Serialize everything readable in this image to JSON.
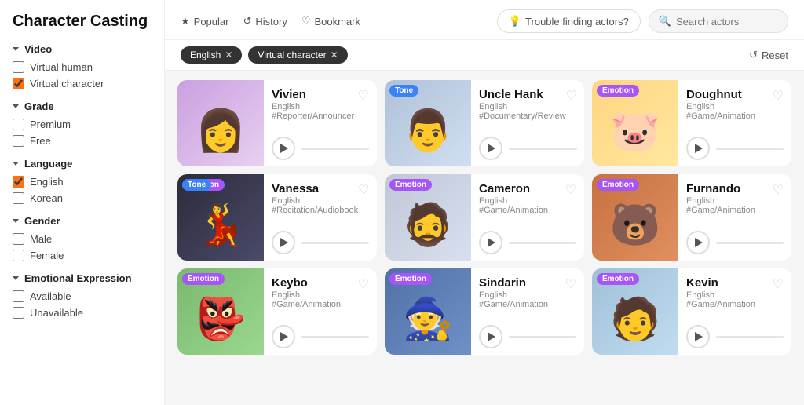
{
  "sidebar": {
    "title": "Character Casting",
    "filters": {
      "video": {
        "label": "Video",
        "options": [
          {
            "id": "virtual-human",
            "label": "Virtual human",
            "checked": false
          },
          {
            "id": "virtual-character",
            "label": "Virtual character",
            "checked": true
          }
        ]
      },
      "grade": {
        "label": "Grade",
        "options": [
          {
            "id": "premium",
            "label": "Premium",
            "checked": false
          },
          {
            "id": "free",
            "label": "Free",
            "checked": false
          }
        ]
      },
      "language": {
        "label": "Language",
        "options": [
          {
            "id": "english",
            "label": "English",
            "checked": true
          },
          {
            "id": "korean",
            "label": "Korean",
            "checked": false
          }
        ]
      },
      "gender": {
        "label": "Gender",
        "options": [
          {
            "id": "male",
            "label": "Male",
            "checked": false
          },
          {
            "id": "female",
            "label": "Female",
            "checked": false
          }
        ]
      },
      "emotional_expression": {
        "label": "Emotional Expression",
        "options": [
          {
            "id": "available",
            "label": "Available",
            "checked": false
          },
          {
            "id": "unavailable",
            "label": "Unavailable",
            "checked": false
          }
        ]
      }
    }
  },
  "topbar": {
    "tabs": [
      {
        "id": "popular",
        "label": "Popular",
        "icon": "★"
      },
      {
        "id": "history",
        "label": "History",
        "icon": "↺"
      },
      {
        "id": "bookmark",
        "label": "Bookmark",
        "icon": "♡"
      }
    ],
    "trouble_btn": "Trouble finding actors?",
    "search_placeholder": "Search actors"
  },
  "filter_tags": [
    {
      "label": "English",
      "id": "tag-english"
    },
    {
      "label": "Virtual character",
      "id": "tag-virtual-character"
    }
  ],
  "reset_label": "Reset",
  "cards": [
    {
      "id": "vivien",
      "name": "Vivien",
      "lang": "English",
      "tag": "#Reporter/Announcer",
      "badges": [],
      "bg_class": "char-vivien",
      "emoji": "👩"
    },
    {
      "id": "uncle-hank",
      "name": "Uncle Hank",
      "lang": "English",
      "tag": "#Documentary/Review",
      "badges": [
        "Tone"
      ],
      "bg_class": "char-uncle-hank",
      "emoji": "👨"
    },
    {
      "id": "doughnut",
      "name": "Doughnut",
      "lang": "English",
      "tag": "#Game/Animation",
      "badges": [
        "Emotion"
      ],
      "bg_class": "char-doughnut",
      "emoji": "🐷"
    },
    {
      "id": "vanessa",
      "name": "Vanessa",
      "lang": "English",
      "tag": "#Recitation/Audiobook",
      "badges": [
        "Emotion",
        "Tone"
      ],
      "bg_class": "char-vanessa",
      "emoji": "💃"
    },
    {
      "id": "cameron",
      "name": "Cameron",
      "lang": "English",
      "tag": "#Game/Animation",
      "badges": [
        "Emotion"
      ],
      "bg_class": "char-cameron",
      "emoji": "🧔"
    },
    {
      "id": "furnando",
      "name": "Furnando",
      "lang": "English",
      "tag": "#Game/Animation",
      "badges": [
        "Emotion"
      ],
      "bg_class": "char-furnando",
      "emoji": "🐻"
    },
    {
      "id": "keybo",
      "name": "Keybo",
      "lang": "English",
      "tag": "#Game/Animation",
      "badges": [
        "Emotion"
      ],
      "bg_class": "char-keybo",
      "emoji": "👺"
    },
    {
      "id": "sindarin",
      "name": "Sindarin",
      "lang": "English",
      "tag": "#Game/Animation",
      "badges": [
        "Emotion"
      ],
      "bg_class": "char-sindarin",
      "emoji": "🧙"
    },
    {
      "id": "kevin",
      "name": "Kevin",
      "lang": "English",
      "tag": "#Game/Animation",
      "badges": [
        "Emotion"
      ],
      "bg_class": "char-kevin",
      "emoji": "🧑"
    }
  ]
}
